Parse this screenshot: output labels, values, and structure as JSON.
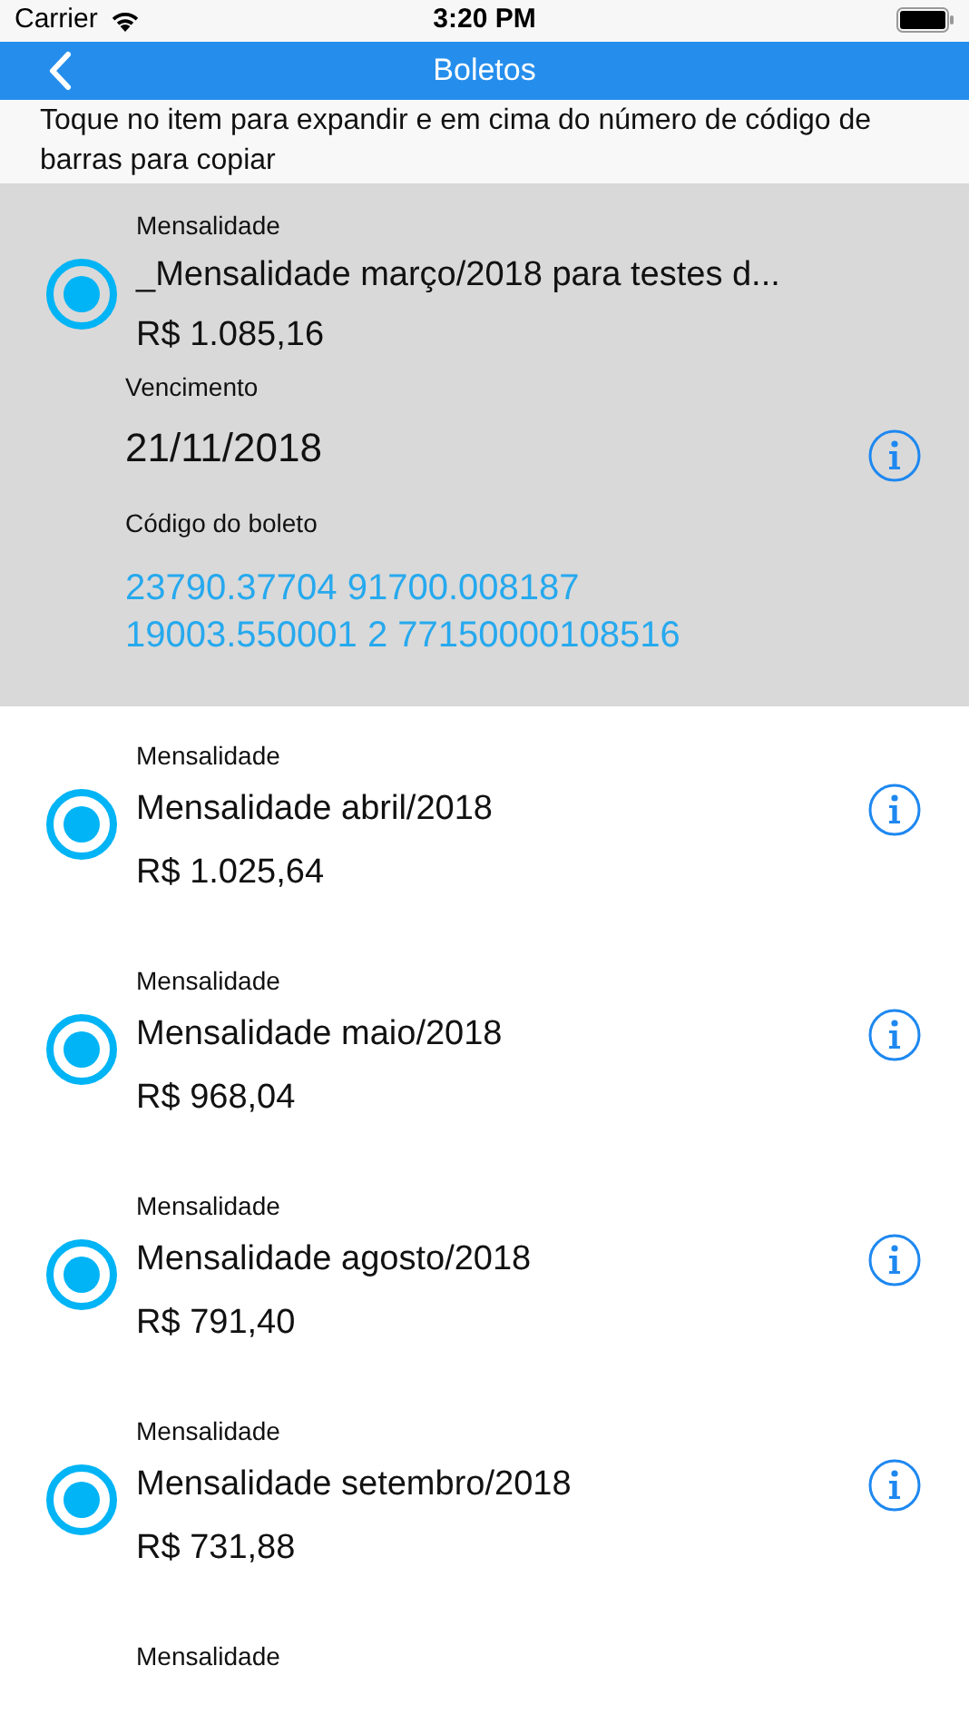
{
  "status_bar": {
    "carrier": "Carrier",
    "time": "3:20 PM"
  },
  "nav": {
    "title": "Boletos"
  },
  "instructions": "Toque no item para expandir e em cima do número de código de barras para copiar",
  "items": [
    {
      "category": "Mensalidade",
      "title": "_Mensalidade março/2018 para testes d...",
      "amount": "R$ 1.085,16",
      "expanded": true,
      "due_label": "Vencimento",
      "due_date": "21/11/2018",
      "code_label": "Código do boleto",
      "code_lines": [
        "23790.37704 91700.008187",
        "19003.550001 2 77150000108516"
      ]
    },
    {
      "category": "Mensalidade",
      "title": "Mensalidade abril/2018",
      "amount": "R$ 1.025,64",
      "expanded": false
    },
    {
      "category": "Mensalidade",
      "title": "Mensalidade maio/2018",
      "amount": "R$ 968,04",
      "expanded": false
    },
    {
      "category": "Mensalidade",
      "title": "Mensalidade agosto/2018",
      "amount": "R$ 791,40",
      "expanded": false
    },
    {
      "category": "Mensalidade",
      "title": "Mensalidade setembro/2018",
      "amount": "R$ 731,88",
      "expanded": false
    },
    {
      "category": "Mensalidade",
      "expanded": false
    }
  ]
}
